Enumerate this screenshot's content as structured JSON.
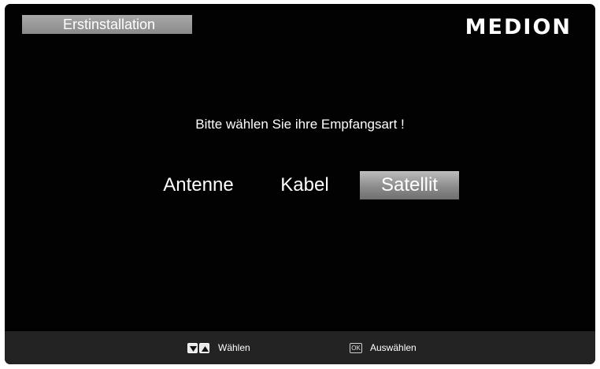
{
  "header": {
    "title": "Erstinstallation",
    "logo_text": "MEDION"
  },
  "main": {
    "prompt": "Bitte wählen Sie ihre Empfangsart !",
    "options": [
      {
        "label": "Antenne",
        "selected": false
      },
      {
        "label": "Kabel",
        "selected": false
      },
      {
        "label": "Satellit",
        "selected": true
      }
    ]
  },
  "footer": {
    "select_hint": "Wählen",
    "confirm_key": "OK",
    "confirm_hint": "Auswählen"
  },
  "colors": {
    "background": "#020202",
    "title_bar": "#9a9a9a",
    "selected_option": "#9a9a9a",
    "bottom_bar": "#232323",
    "text": "#ffffff"
  }
}
